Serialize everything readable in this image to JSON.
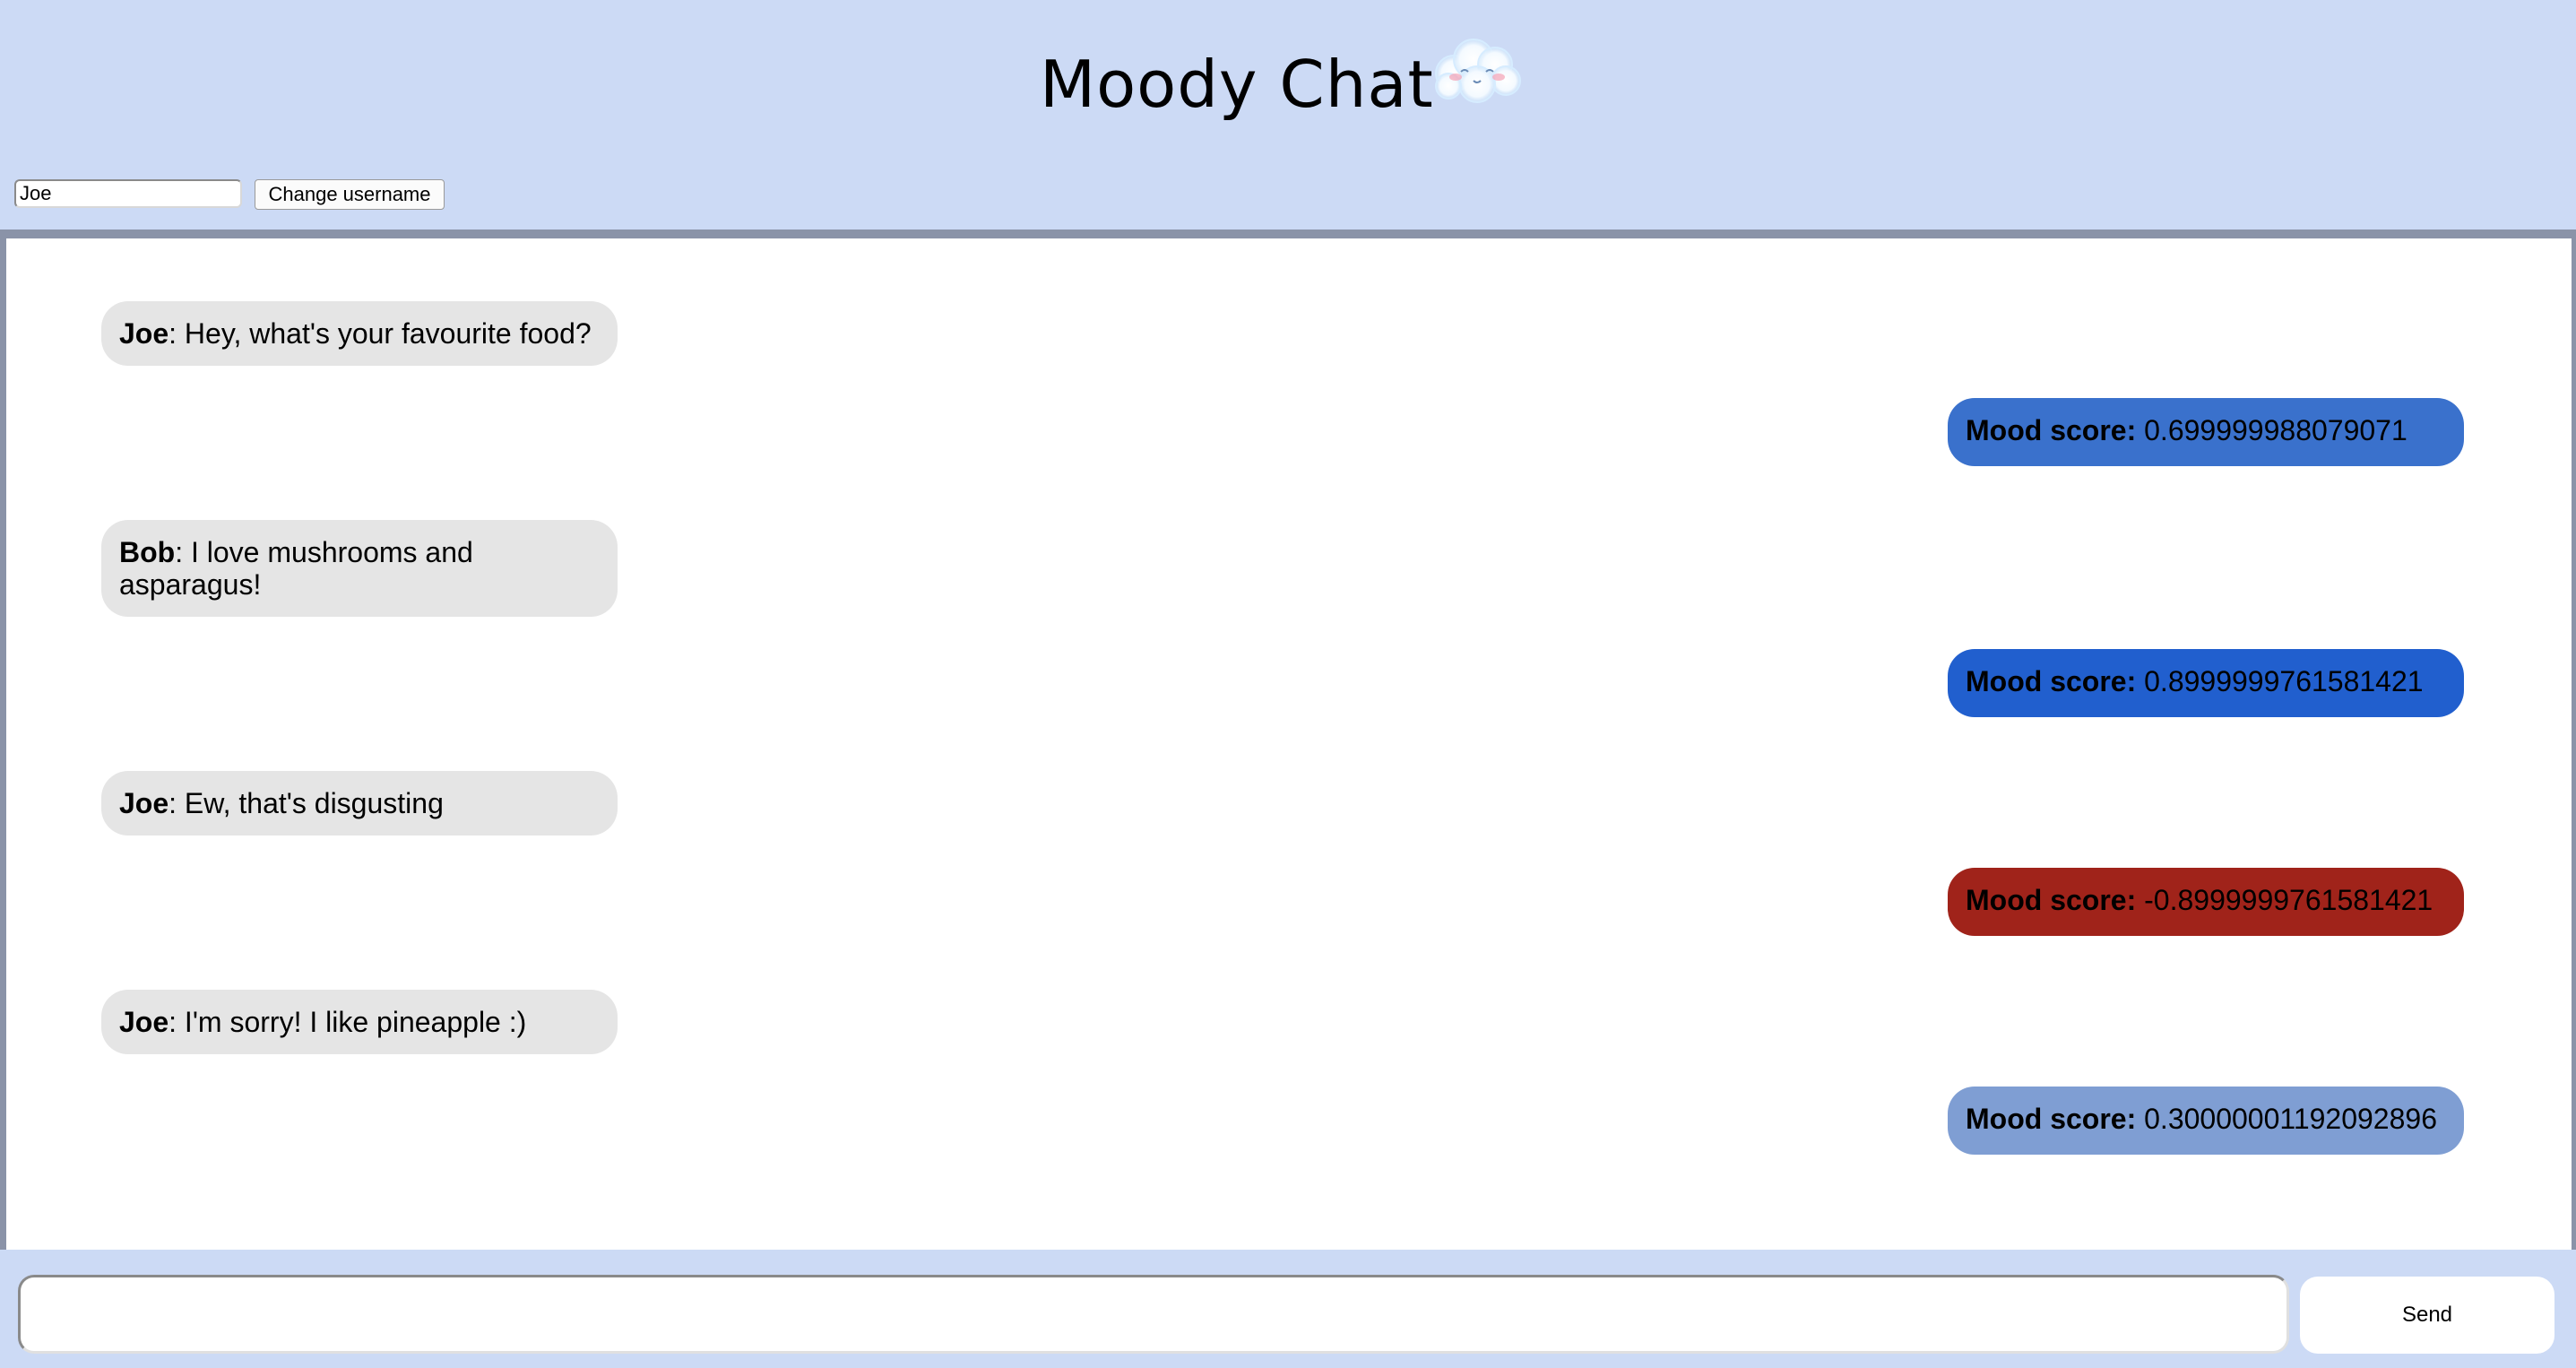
{
  "app": {
    "title": "Moody Chat",
    "logo_icon": "cloud-face-icon"
  },
  "username": {
    "value": "Joe",
    "button_label": "Change username"
  },
  "messages": [
    {
      "sender": "Joe",
      "text": ": Hey, what's your favourite food?",
      "mood_label": "Mood score:",
      "mood_value": "0.699999988079071",
      "mood_color": "#3a71cc"
    },
    {
      "sender": "Bob",
      "text": ": I love mushrooms and asparagus!",
      "mood_label": "Mood score:",
      "mood_value": "0.8999999761581421",
      "mood_color": "#215fce"
    },
    {
      "sender": "Joe",
      "text": ": Ew, that's disgusting",
      "mood_label": "Mood score:",
      "mood_value": "-0.8999999761581421",
      "mood_color": "#a0231a"
    },
    {
      "sender": "Joe",
      "text": ": I'm sorry! I like pineapple :)",
      "mood_label": "Mood score:",
      "mood_value": "0.30000001192092896",
      "mood_color": "#7f9ed3"
    }
  ],
  "composer": {
    "value": "",
    "send_label": "Send"
  },
  "colors": {
    "background": "#ccdaf5",
    "chat_border": "#8a93a8",
    "message_bubble": "#e5e5e5"
  }
}
